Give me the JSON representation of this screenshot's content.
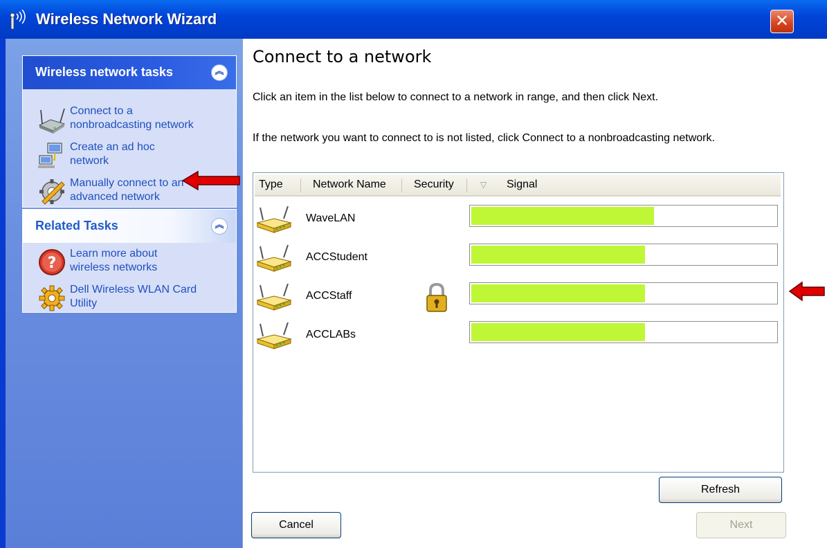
{
  "window": {
    "title": "Wireless Network Wizard",
    "close_label": "✕"
  },
  "sidebar": {
    "tasks_panel": {
      "title": "Wireless network tasks",
      "items": [
        {
          "label_line1": "Connect to a",
          "label_line2": "nonbroadcasting network",
          "icon": "network-device-icon"
        },
        {
          "label_line1": "Create an ad hoc",
          "label_line2": "network",
          "icon": "computer-network-icon"
        },
        {
          "label_line1": "Manually connect to an",
          "label_line2": "advanced network",
          "icon": "gear-wrench-icon"
        }
      ]
    },
    "related_panel": {
      "title": "Related Tasks",
      "items": [
        {
          "label_line1": "Learn more about",
          "label_line2": "wireless networks",
          "icon": "help-icon"
        },
        {
          "label_line1": "Dell Wireless WLAN Card",
          "label_line2": "Utility",
          "icon": "gear-icon"
        }
      ]
    }
  },
  "main": {
    "title": "Connect to a network",
    "instruction1": "Click an item in the list below to connect to a network in range, and then click Next.",
    "instruction2": "If the network you want to connect to is not listed, click Connect to a nonbroadcasting network.",
    "columns": [
      "Type",
      "Network Name",
      "Security",
      "Signal"
    ],
    "sort_indicator": "▽",
    "networks": [
      {
        "name": "WaveLAN",
        "secured": false,
        "signal": 0.6
      },
      {
        "name": "ACCStudent",
        "secured": false,
        "signal": 0.57
      },
      {
        "name": "ACCStaff",
        "secured": true,
        "signal": 0.57
      },
      {
        "name": "ACCLABs",
        "secured": false,
        "signal": 0.57
      }
    ],
    "buttons": {
      "refresh": "Refresh",
      "cancel": "Cancel",
      "next": "Next"
    }
  },
  "colors": {
    "signal": "#bff736",
    "title_bar": "#0045d8",
    "annotation_arrow": "#e00000"
  }
}
